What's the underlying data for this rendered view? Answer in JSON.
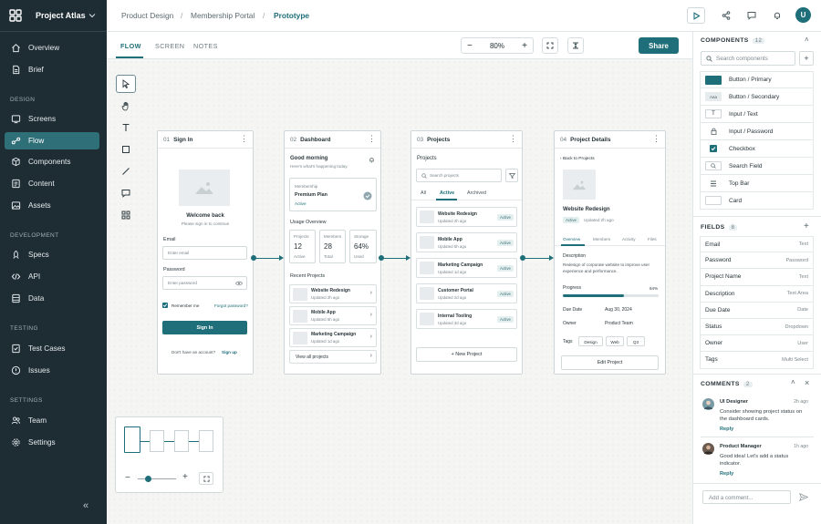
{
  "sidebar": {
    "title": "Project Atlas",
    "items_top": [
      {
        "label": "Overview",
        "icon": "home-icon"
      },
      {
        "label": "Brief",
        "icon": "document-icon"
      }
    ],
    "sections": [
      {
        "label": "DESIGN",
        "items": [
          {
            "label": "Screens",
            "icon": "screens-icon"
          },
          {
            "label": "Flow",
            "icon": "flow-icon",
            "active": true
          },
          {
            "label": "Components",
            "icon": "components-icon"
          },
          {
            "label": "Content",
            "icon": "content-icon"
          },
          {
            "label": "Assets",
            "icon": "image-icon"
          }
        ]
      },
      {
        "label": "DEVELOPMENT",
        "items": [
          {
            "label": "Specs",
            "icon": "rocket-icon"
          },
          {
            "label": "API",
            "icon": "code-icon"
          },
          {
            "label": "Data",
            "icon": "data-icon"
          }
        ]
      },
      {
        "label": "TESTING",
        "items": [
          {
            "label": "Test Cases",
            "icon": "test-icon"
          },
          {
            "label": "Issues",
            "icon": "alert-icon"
          }
        ]
      },
      {
        "label": "SETTINGS",
        "items": [
          {
            "label": "Team",
            "icon": "team-icon"
          },
          {
            "label": "Settings",
            "icon": "gear-icon"
          }
        ]
      }
    ]
  },
  "header": {
    "breadcrumb": [
      "Product Design",
      "Membership Portal",
      "Prototype"
    ],
    "avatar": "U"
  },
  "toolbar": {
    "tabs": [
      "FLOW",
      "SCREEN",
      "NOTES"
    ],
    "zoom": "80%",
    "share": "Share"
  },
  "frames": {
    "signin": {
      "num": "01",
      "title": "Sign In",
      "welcome": "Welcome back",
      "subtitle": "Please sign in to continue",
      "email_label": "Email",
      "email_ph": "Enter email",
      "password_label": "Password",
      "password_ph": "Enter password",
      "remember": "Remember me",
      "forgot": "Forgot password?",
      "button": "Sign In",
      "no_account": "Don't have an account?",
      "signup": "Sign up"
    },
    "dashboard": {
      "num": "02",
      "title": "Dashboard",
      "greeting": "Good morning",
      "greeting_sub": "Here's what's happening today.",
      "membership_label": "Membership",
      "plan": "Premium Plan",
      "plan_status": "Active",
      "usage": "Usage Overview",
      "stats": [
        {
          "label": "Projects",
          "value": "12",
          "sub": "Active"
        },
        {
          "label": "Members",
          "value": "28",
          "sub": "Total"
        },
        {
          "label": "Storage",
          "value": "64%",
          "sub": "Used"
        }
      ],
      "recent": "Recent Projects",
      "projects": [
        {
          "name": "Website Redesign",
          "time": "Updated 2h ago"
        },
        {
          "name": "Mobile App",
          "time": "Updated 5h ago"
        },
        {
          "name": "Marketing Campaign",
          "time": "Updated 1d ago"
        }
      ],
      "view_all": "View all projects"
    },
    "projects": {
      "num": "03",
      "title": "Projects",
      "heading": "Projects",
      "search_ph": "Search projects",
      "tabs": [
        "All",
        "Active",
        "Archived"
      ],
      "items": [
        {
          "name": "Website Redesign",
          "time": "Updated 2h ago",
          "status": "Active"
        },
        {
          "name": "Mobile App",
          "time": "Updated 5h ago",
          "status": "Active"
        },
        {
          "name": "Marketing Campaign",
          "time": "Updated 1d ago",
          "status": "Active"
        },
        {
          "name": "Customer Portal",
          "time": "Updated 2d ago",
          "status": "Active"
        },
        {
          "name": "Internal Tooling",
          "time": "Updated 3d ago",
          "status": "Active"
        }
      ],
      "new_button": "New Project"
    },
    "details": {
      "num": "04",
      "title": "Project Details",
      "back": "Back to Projects",
      "name": "Website Redesign",
      "status": "Active",
      "time": "Updated 2h ago",
      "tabs": [
        "Overview",
        "Members",
        "Activity",
        "Files"
      ],
      "desc_label": "Description",
      "desc": "Redesign of corporate website to improve user experience and performance.",
      "progress_label": "Progress",
      "progress_text": "64%",
      "progress": 0.64,
      "due_label": "Due Date",
      "due": "Aug 30, 2024",
      "owner_label": "Owner",
      "owner": "Product Team",
      "tags_label": "Tags",
      "tags": [
        "Design",
        "Web",
        "Q3"
      ],
      "edit": "Edit Project"
    }
  },
  "components": {
    "title": "COMPONENTS",
    "count": "12",
    "search_ph": "Search components",
    "items": [
      {
        "label": "Button / Primary",
        "icon": "primary-button-swatch"
      },
      {
        "label": "Button / Secondary",
        "icon": "secondary-button-swatch",
        "chip": "Aaa"
      },
      {
        "label": "Input / Text",
        "icon": "text-icon"
      },
      {
        "label": "Input / Password",
        "icon": "lock-icon"
      },
      {
        "label": "Checkbox",
        "icon": "checkbox-icon"
      },
      {
        "label": "Search Field",
        "icon": "search-icon"
      },
      {
        "label": "Top Bar",
        "icon": "topbar-icon"
      },
      {
        "label": "Card",
        "icon": "card-icon"
      }
    ]
  },
  "fields": {
    "title": "FIELDS",
    "count": "8",
    "items": [
      {
        "name": "Email",
        "type": "Text"
      },
      {
        "name": "Password",
        "type": "Password"
      },
      {
        "name": "Project Name",
        "type": "Text"
      },
      {
        "name": "Description",
        "type": "Text Area"
      },
      {
        "name": "Due Date",
        "type": "Date"
      },
      {
        "name": "Status",
        "type": "Dropdown"
      },
      {
        "name": "Owner",
        "type": "User"
      },
      {
        "name": "Tags",
        "type": "Multi Select"
      }
    ]
  },
  "comments": {
    "title": "COMMENTS",
    "count": "2",
    "items": [
      {
        "author": "UI Designer",
        "time": "2h ago",
        "text": "Consider showing project status on the dashboard cards.",
        "reply": "Reply"
      },
      {
        "author": "Product Manager",
        "time": "1h ago",
        "text": "Good idea! Let's add a status indicator.",
        "reply": "Reply"
      }
    ],
    "add_ph": "Add a comment..."
  },
  "colors": {
    "accent": "#1e6f79",
    "sidebar": "#1e2c33"
  }
}
